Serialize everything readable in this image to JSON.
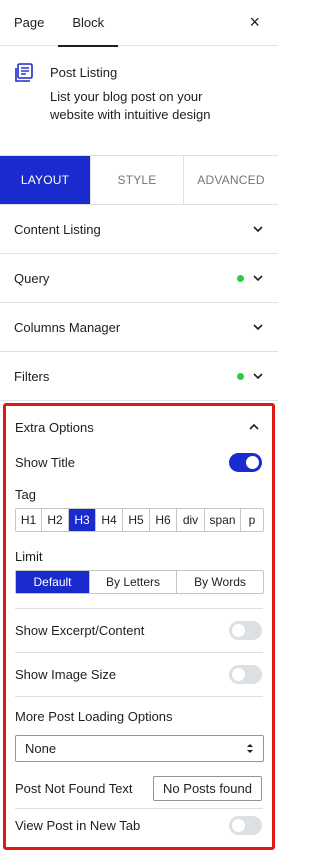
{
  "top_tabs": {
    "page": "Page",
    "block": "Block",
    "close": "×"
  },
  "block": {
    "title": "Post Listing",
    "description": "List your blog post on your website with intuitive design",
    "icon": "post-listing-icon"
  },
  "mode_tabs": {
    "layout": "LAYOUT",
    "style": "STYLE",
    "advanced": "ADVANCED"
  },
  "panels": {
    "content_listing": "Content Listing",
    "query": "Query",
    "columns_manager": "Columns Manager",
    "filters": "Filters"
  },
  "extra": {
    "title": "Extra Options",
    "show_title": "Show Title",
    "tag_label": "Tag",
    "tags": [
      "H1",
      "H2",
      "H3",
      "H4",
      "H5",
      "H6",
      "div",
      "span",
      "p"
    ],
    "tag_selected": "H3",
    "limit_label": "Limit",
    "limits": [
      "Default",
      "By Letters",
      "By Words"
    ],
    "limit_selected": "Default",
    "show_excerpt": "Show Excerpt/Content",
    "show_image_size": "Show Image Size",
    "more_loading_label": "More Post Loading Options",
    "more_loading_value": "None",
    "not_found_label": "Post Not Found Text",
    "not_found_value": "No Posts found",
    "new_tab_label": "View Post in New Tab"
  },
  "colors": {
    "accent": "#1a2bce",
    "status_dot": "#2ecc40",
    "highlight_border": "#e11818"
  }
}
